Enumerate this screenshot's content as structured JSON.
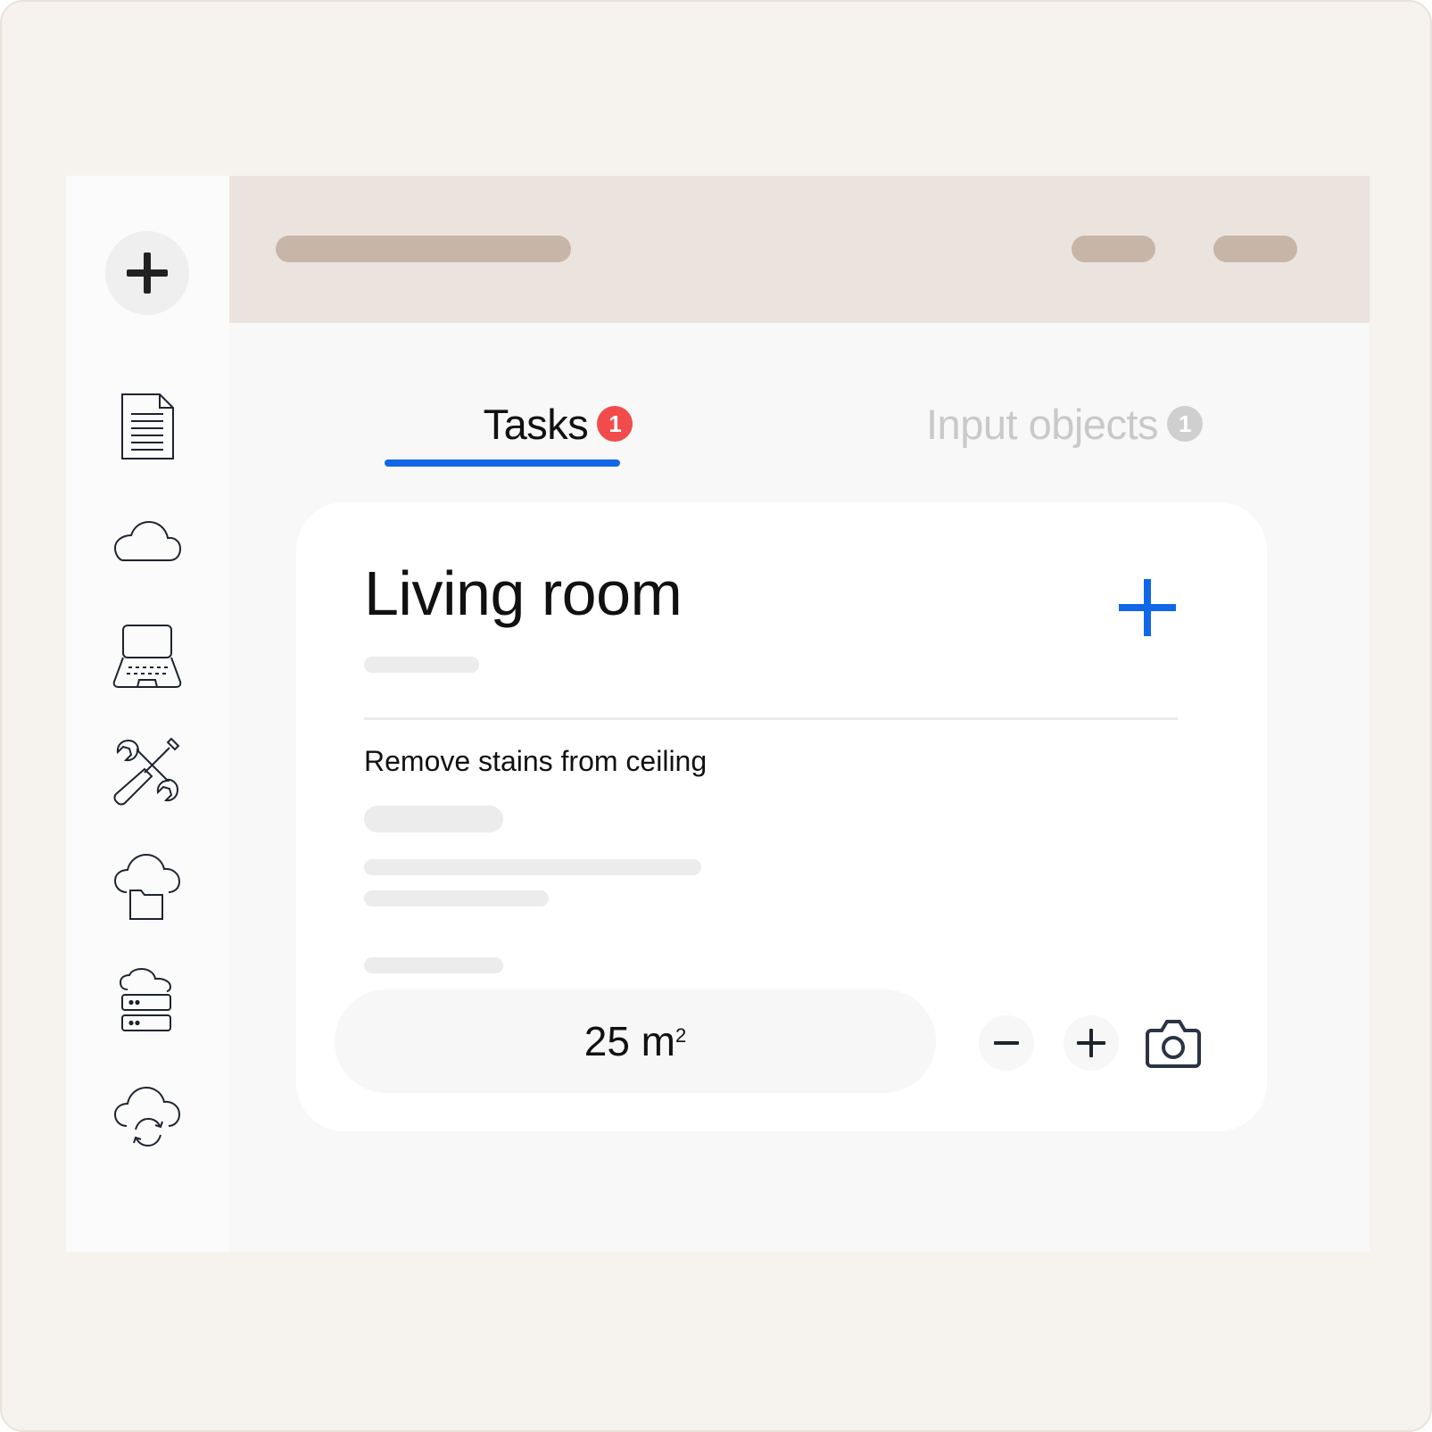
{
  "tabs": [
    {
      "label": "Tasks",
      "badge": "1",
      "active": true,
      "badge_color": "#f24b4b"
    },
    {
      "label": "Input objects",
      "badge": "1",
      "active": false,
      "badge_color": "#cfcfcf"
    }
  ],
  "sidebar": {
    "items": [
      {
        "icon": "document-icon"
      },
      {
        "icon": "cloud-icon"
      },
      {
        "icon": "laptop-icon"
      },
      {
        "icon": "tools-icon"
      },
      {
        "icon": "cloud-folder-icon"
      },
      {
        "icon": "cloud-server-icon"
      },
      {
        "icon": "cloud-sync-icon"
      }
    ]
  },
  "card": {
    "title": "Living room",
    "task": "Remove stains from ceiling",
    "area": {
      "value": "25 m",
      "unit_superscript": "2"
    }
  },
  "colors": {
    "accent": "#1167e8",
    "topbar": "#ebe3de",
    "placeholder_pill": "#c7b6a8",
    "frame_background": "#f6f3ef"
  }
}
